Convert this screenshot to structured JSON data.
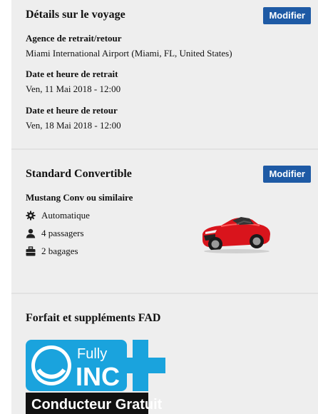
{
  "trip": {
    "title": "Détails sur le voyage",
    "modify_label": "Modifier",
    "pickup_return_label": "Agence de retrait/retour",
    "pickup_return_value": "Miami International Airport (Miami, FL, United States)",
    "pickup_label": "Date et heure de retrait",
    "pickup_value": "Ven, 11 Mai 2018 - 12:00",
    "return_label": "Date et heure de retour",
    "return_value": "Ven, 18 Mai 2018 - 12:00"
  },
  "vehicle": {
    "title": "Standard Convertible",
    "modify_label": "Modifier",
    "model": "Mustang Conv ou similaire",
    "features": [
      {
        "icon": "gear-icon",
        "label": "Automatique"
      },
      {
        "icon": "person-icon",
        "label": "4 passagers"
      },
      {
        "icon": "luggage-icon",
        "label": "2 bagages"
      }
    ],
    "car_color": "#d9141c"
  },
  "package": {
    "title": "Forfait et suppléments FAD",
    "logo_text_1": "Fully",
    "logo_text_2": "INC",
    "logo_text_3": "Conducteur Gratuit",
    "logo_color": "#1aa3dd"
  },
  "colors": {
    "button": "#1e5aa5",
    "panel": "#eeeeee"
  }
}
